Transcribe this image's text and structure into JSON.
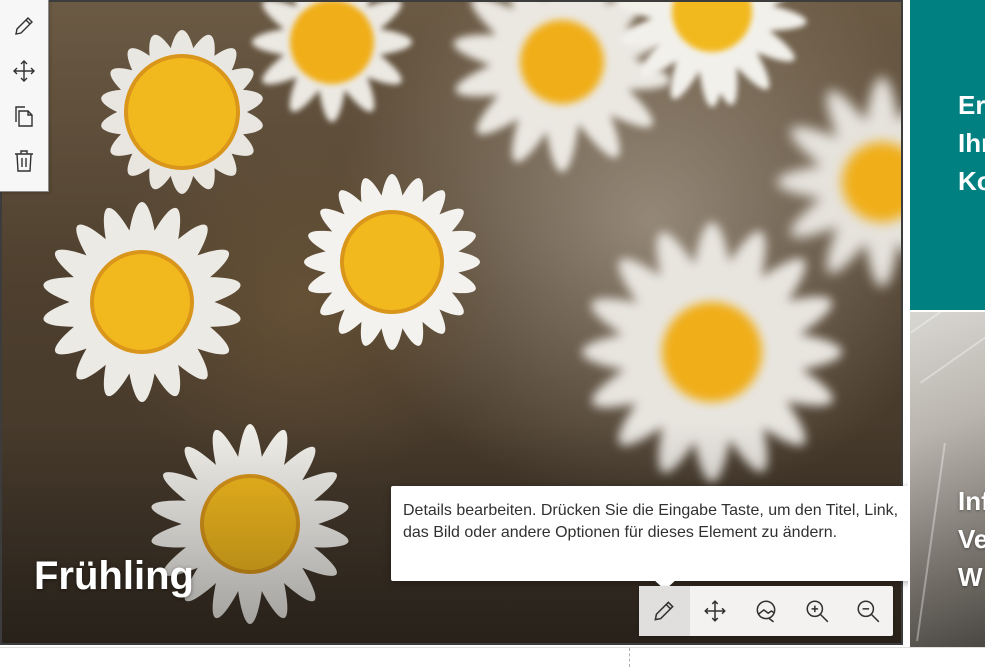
{
  "hero": {
    "title": "Frühling"
  },
  "left_toolbar": {
    "items": [
      {
        "icon": "pencil-icon"
      },
      {
        "icon": "move-icon"
      },
      {
        "icon": "duplicate-icon"
      },
      {
        "icon": "trash-icon"
      }
    ]
  },
  "tooltip": {
    "text": "Details bearbeiten. Drücken Sie die Eingabe Taste, um den Titel, Link, das Bild oder andere Optionen für dieses Element zu ändern."
  },
  "image_toolbar": {
    "items": [
      {
        "icon": "pencil-icon"
      },
      {
        "icon": "move-icon"
      },
      {
        "icon": "focal-point-icon"
      },
      {
        "icon": "zoom-in-icon"
      },
      {
        "icon": "zoom-out-icon"
      }
    ]
  },
  "right_tiles": {
    "teal_title": "Erf\nIhr\nKo",
    "photo_title": "Inf\nVe\nW"
  },
  "colors": {
    "teal": "#008080",
    "flower_center": "#f2b91e",
    "petal": "#f4f2ee"
  }
}
